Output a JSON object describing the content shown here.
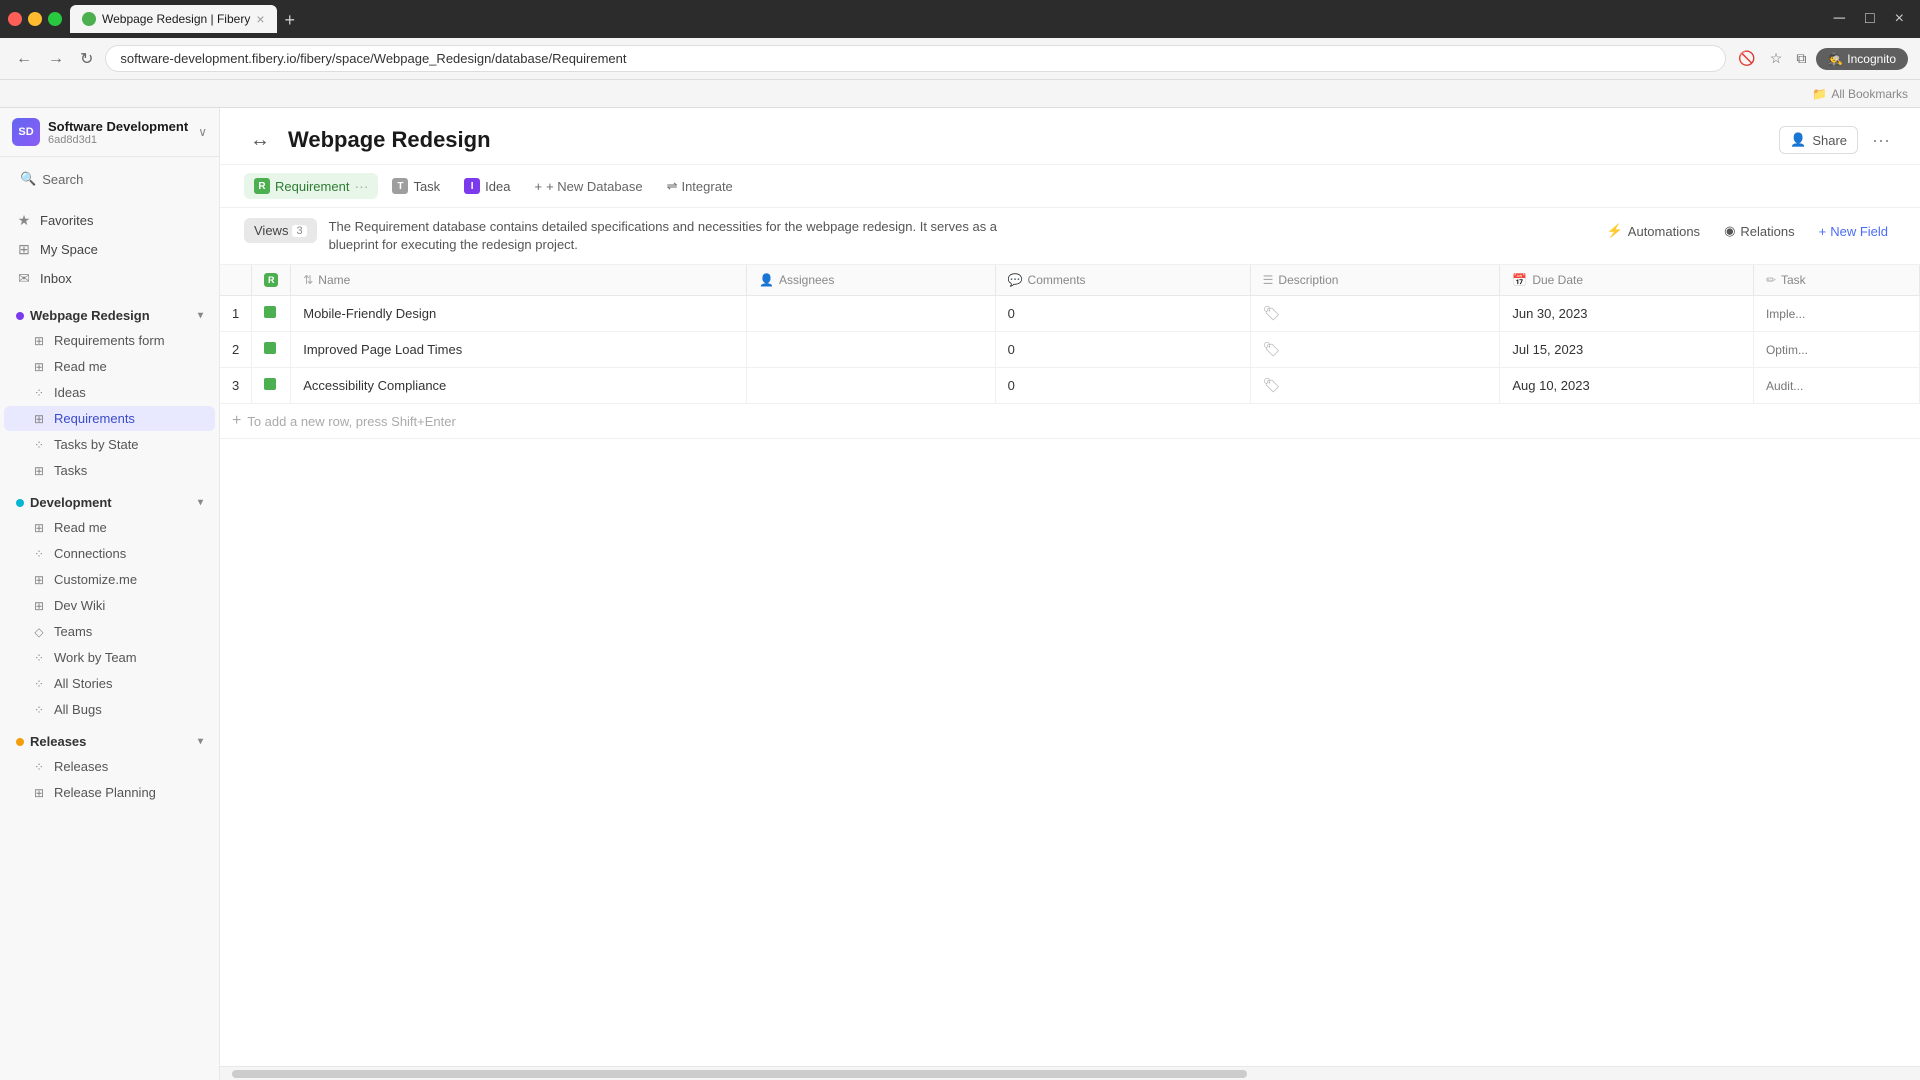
{
  "browser": {
    "tab_title": "Webpage Redesign | Fibery",
    "tab_favicon_color": "#4caf50",
    "address_url": "software-development.fibery.io/fibery/space/Webpage_Redesign/database/Requirement",
    "new_tab_label": "+",
    "incognito_label": "Incognito",
    "bookmarks_label": "All Bookmarks",
    "nav_back": "←",
    "nav_forward": "→",
    "nav_reload": "↻"
  },
  "workspace": {
    "name": "Software Development",
    "id": "6ad8d3d1",
    "icon_letters": "SD"
  },
  "sidebar": {
    "search_label": "Search",
    "items": [
      {
        "id": "favorites",
        "label": "Favorites",
        "icon": "★"
      },
      {
        "id": "my-space",
        "label": "My Space",
        "icon": "⊞"
      },
      {
        "id": "inbox",
        "label": "Inbox",
        "icon": "✉"
      }
    ],
    "sections": [
      {
        "id": "webpage-redesign",
        "label": "Webpage Redesign",
        "dot_color": "#7c3aed",
        "active": true,
        "sub_items": [
          {
            "id": "requirements-form",
            "label": "Requirements form",
            "icon": "⊞"
          },
          {
            "id": "read-me-wr",
            "label": "Read me",
            "icon": "⊞"
          },
          {
            "id": "ideas",
            "label": "Ideas",
            "icon": "⁘"
          },
          {
            "id": "requirements",
            "label": "Requirements",
            "icon": "⊞",
            "active": true
          },
          {
            "id": "tasks-by-state",
            "label": "Tasks by State",
            "icon": "⁘"
          },
          {
            "id": "tasks",
            "label": "Tasks",
            "icon": "⊞"
          }
        ]
      },
      {
        "id": "development",
        "label": "Development",
        "dot_color": "#06b6d4",
        "sub_items": [
          {
            "id": "read-me-dev",
            "label": "Read me",
            "icon": "⊞"
          },
          {
            "id": "connections",
            "label": "Connections",
            "icon": "⁘"
          },
          {
            "id": "customize-me",
            "label": "Customize.me",
            "icon": "⊞"
          },
          {
            "id": "dev-wiki",
            "label": "Dev Wiki",
            "icon": "⊞"
          },
          {
            "id": "teams",
            "label": "Teams",
            "icon": "◇"
          },
          {
            "id": "work-by-team",
            "label": "Work by Team",
            "icon": "⁘"
          },
          {
            "id": "all-stories",
            "label": "All Stories",
            "icon": "⁘"
          },
          {
            "id": "all-bugs",
            "label": "All Bugs",
            "icon": "⁘"
          }
        ]
      },
      {
        "id": "releases",
        "label": "Releases",
        "dot_color": "#f59e0b",
        "sub_items": [
          {
            "id": "releases-item",
            "label": "Releases",
            "icon": "⁘"
          },
          {
            "id": "release-planning",
            "label": "Release Planning",
            "icon": "⊞"
          }
        ]
      }
    ]
  },
  "page": {
    "icon": "↔",
    "title": "Webpage Redesign",
    "share_label": "Share",
    "more_label": "···"
  },
  "db_tabs": [
    {
      "id": "requirement",
      "label": "Requirement",
      "icon_bg": "#4caf50",
      "icon_letter": "R",
      "active": true,
      "dots": "···"
    },
    {
      "id": "task",
      "label": "Task",
      "icon_bg": "#9e9e9e",
      "icon_letter": "T",
      "active": false
    },
    {
      "id": "idea",
      "label": "Idea",
      "icon_bg": "#7c3aed",
      "icon_letter": "I",
      "active": false
    }
  ],
  "toolbar": {
    "views_label": "Views",
    "views_count": "3",
    "description": "The Requirement database contains detailed specifications and necessities for the webpage redesign. It serves as a blueprint for executing the redesign project.",
    "automations_label": "Automations",
    "relations_label": "Relations",
    "new_field_label": "New Field",
    "add_db_label": "+ New Database",
    "integrate_label": "Integrate"
  },
  "table": {
    "columns": [
      {
        "id": "num",
        "label": ""
      },
      {
        "id": "r-badge",
        "label": ""
      },
      {
        "id": "name",
        "label": "Name",
        "icon": "⇅"
      },
      {
        "id": "assignees",
        "label": "Assignees",
        "icon": "👤"
      },
      {
        "id": "comments",
        "label": "Comments",
        "icon": "💬"
      },
      {
        "id": "description",
        "label": "Description",
        "icon": "☰"
      },
      {
        "id": "due-date",
        "label": "Due Date",
        "icon": "📅"
      },
      {
        "id": "task",
        "label": "Task",
        "icon": "✏"
      }
    ],
    "rows": [
      {
        "num": "1",
        "name": "Mobile-Friendly Design",
        "assignees": "",
        "comments": "0",
        "description_icon": "🏷",
        "due_date": "Jun 30, 2023",
        "task_preview": "Imple..."
      },
      {
        "num": "2",
        "name": "Improved Page Load Times",
        "assignees": "",
        "comments": "0",
        "description_icon": "🏷",
        "due_date": "Jul 15, 2023",
        "task_preview": "Optim..."
      },
      {
        "num": "3",
        "name": "Accessibility Compliance",
        "assignees": "",
        "comments": "0",
        "description_icon": "🏷",
        "due_date": "Aug 10, 2023",
        "task_preview": "Audit..."
      }
    ],
    "add_row_hint": "To add a new row, press Shift+Enter"
  }
}
